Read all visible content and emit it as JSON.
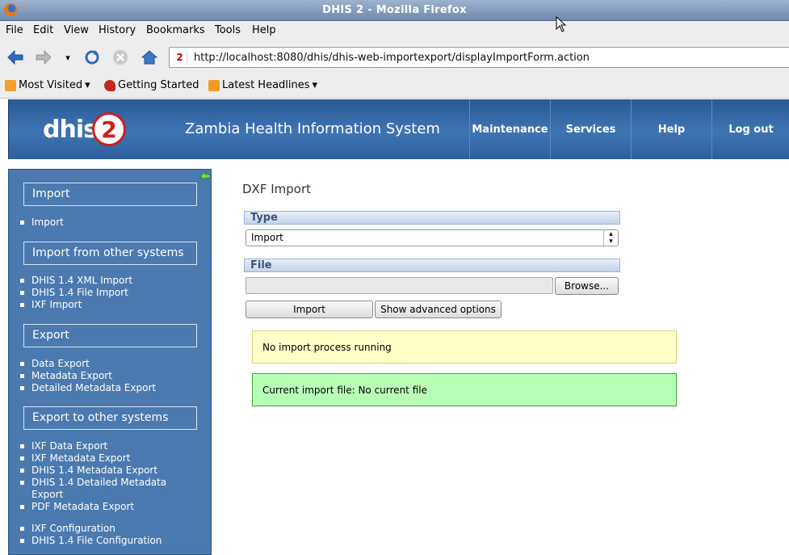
{
  "window": {
    "title": "DHIS 2 - Mozilla Firefox"
  },
  "menubar": [
    "File",
    "Edit",
    "View",
    "History",
    "Bookmarks",
    "Tools",
    "Help"
  ],
  "toolbar": {
    "url": "http://localhost:8080/dhis/dhis-web-importexport/displayImportForm.action"
  },
  "bookmarks": [
    "Most Visited",
    "Getting Started",
    "Latest Headlines"
  ],
  "header": {
    "logo_text": "dhis",
    "logo_num": "2",
    "system_name": "Zambia Health Information System",
    "menu": [
      "Maintenance",
      "Services",
      "Help",
      "Log out"
    ]
  },
  "leftmenu": {
    "sections": [
      {
        "title": "Import",
        "items": [
          "Import"
        ]
      },
      {
        "title": "Import from other systems",
        "items": [
          "DHIS 1.4 XML Import",
          "DHIS 1.4 File Import",
          "IXF Import"
        ]
      },
      {
        "title": "Export",
        "items": [
          "Data Export",
          "Metadata Export",
          "Detailed Metadata Export"
        ]
      },
      {
        "title": "Export to other systems",
        "items": [
          "IXF Data Export",
          "IXF Metadata Export",
          "DHIS 1.4 Metadata Export",
          "DHIS 1.4 Detailed Metadata",
          "Export",
          "PDF Metadata Export",
          "IXF Configuration",
          "DHIS 1.4 File Configuration"
        ]
      }
    ]
  },
  "content": {
    "title": "DXF Import",
    "type_label": "Type",
    "type_value": "Import",
    "file_label": "File",
    "browse_label": "Browse...",
    "import_label": "Import",
    "advanced_label": "Show advanced options",
    "status_message": "No import process running",
    "current_file_message": "Current import file: No current file"
  }
}
